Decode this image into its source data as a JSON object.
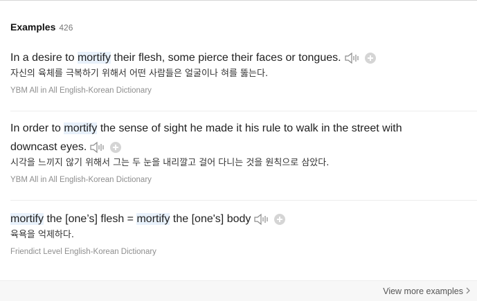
{
  "header": {
    "title": "Examples",
    "count": "426"
  },
  "examples": [
    {
      "en_parts": [
        "In a desire to ",
        "mortify",
        " their flesh, some pierce their faces or tongues."
      ],
      "ko": "자신의 육체를 극복하기 위해서 어떤 사람들은 얼굴이나 혀를 뚫는다.",
      "source": "YBM All in All English-Korean Dictionary"
    },
    {
      "en_parts": [
        "In order to ",
        "mortify",
        " the sense of sight he made it his rule to walk in the street with downcast eyes."
      ],
      "ko": "시각을 느끼지 않기 위해서 그는 두 눈을 내리깔고 걸어 다니는 것을 원칙으로 삼았다.",
      "source": "YBM All in All English-Korean Dictionary"
    },
    {
      "en_parts": [
        "mortify",
        " the [one’s] flesh = ",
        "mortify",
        " the [one's] body"
      ],
      "ko": "육욕을 억제하다.",
      "source": "Friendict Level English-Korean Dictionary"
    }
  ],
  "footer": {
    "view_more": "View more examples"
  },
  "icons": {
    "speaker": "speaker-icon",
    "add": "plus-circle-icon",
    "chevron": "chevron-right-icon"
  }
}
